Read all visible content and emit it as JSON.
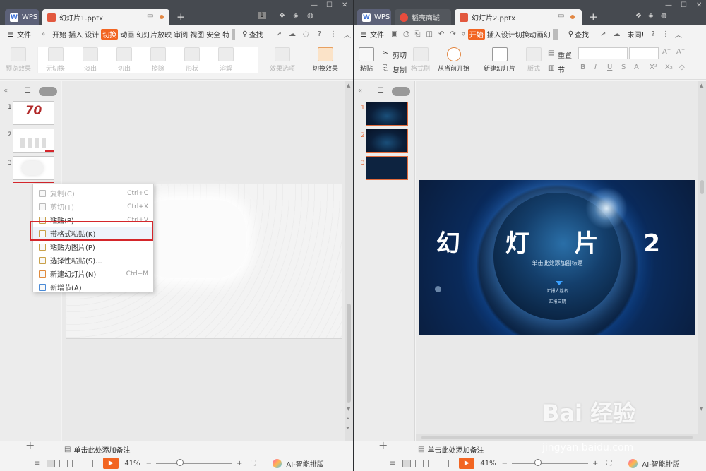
{
  "left_window": {
    "tabs": {
      "wps": "WPS",
      "doc": "幻灯片1.pptx",
      "add": "+"
    },
    "badge": "1",
    "menu": {
      "file": "文件",
      "more": "»",
      "items": [
        "开始",
        "插入",
        "设计",
        "切换",
        "动画",
        "幻灯片放映",
        "审阅",
        "视图",
        "安全",
        "特"
      ],
      "active_item": "切换",
      "find": "查找"
    },
    "toolbar": {
      "preview": "预览效果",
      "transitions": [
        "无切换",
        "淡出",
        "切出",
        "擦除",
        "形状",
        "溶解"
      ],
      "effect_options": "效果选项",
      "switch_effect": "切换效果"
    },
    "slides": [
      "1",
      "2",
      "3"
    ],
    "thumb1_text": "70",
    "context_menu": [
      {
        "label": "复制(C)",
        "shortcut": "Ctrl+C",
        "enabled": false
      },
      {
        "label": "剪切(T)",
        "shortcut": "Ctrl+X",
        "enabled": false
      },
      {
        "label": "粘贴(P)",
        "shortcut": "Ctrl+V",
        "enabled": true
      },
      {
        "label": "带格式粘贴(K)",
        "shortcut": "",
        "enabled": true
      },
      {
        "label": "粘贴为图片(P)",
        "shortcut": "",
        "enabled": true
      },
      {
        "label": "选择性粘贴(S)...",
        "shortcut": "",
        "enabled": true
      },
      {
        "label": "新建幻灯片(N)",
        "shortcut": "Ctrl+M",
        "enabled": true
      },
      {
        "label": "新增节(A)",
        "shortcut": "",
        "enabled": true
      }
    ],
    "add_slide": "+",
    "notes": "单击此处添加备注",
    "status": {
      "zoom": "41%",
      "minus": "−",
      "plus": "+",
      "ai": "AI-智能排版",
      "play": "▶",
      "zoom_fraction": 0.27
    }
  },
  "right_window": {
    "tabs": {
      "wps": "WPS",
      "store": "稻壳商城",
      "doc": "幻灯片2.pptx",
      "add": "+"
    },
    "menu": {
      "file": "文件",
      "items": [
        "开始",
        "插入",
        "设计",
        "切换",
        "动画",
        "幻"
      ],
      "active_item": "开始",
      "find": "查找",
      "sync": "未同!"
    },
    "toolbar": {
      "paste": "粘贴",
      "cut": "剪切",
      "copy": "复制",
      "format_painter": "格式刷",
      "from_current": "从当前开始",
      "new_slide": "新建幻灯片",
      "layout": "版式",
      "reset": "重置",
      "section": "节",
      "font_buttons": [
        "B",
        "I",
        "U",
        "S",
        "A",
        "X²",
        "X₂",
        "◇"
      ],
      "font_size_buttons": [
        "A⁺",
        "A⁻"
      ]
    },
    "slides": [
      "1",
      "2",
      "3"
    ],
    "main_slide": {
      "title": "幻 灯 片 2",
      "subtitle": "单击此处添加副标题",
      "name": "汇报人姓名",
      "date": "汇报日期"
    },
    "add_slide": "+",
    "notes": "单击此处添加备注",
    "status": {
      "zoom": "41%",
      "minus": "−",
      "plus": "+",
      "ai": "AI-智能排版",
      "play": "▶",
      "zoom_fraction": 0.3
    }
  },
  "watermark": {
    "brand": "Bai 经验",
    "url": "jingyan.baidu.com"
  },
  "colors": {
    "accent": "#f26522",
    "highlight_box": "#d4262b",
    "titlebar": "#464a50",
    "slide_bg": "#0b2442"
  }
}
